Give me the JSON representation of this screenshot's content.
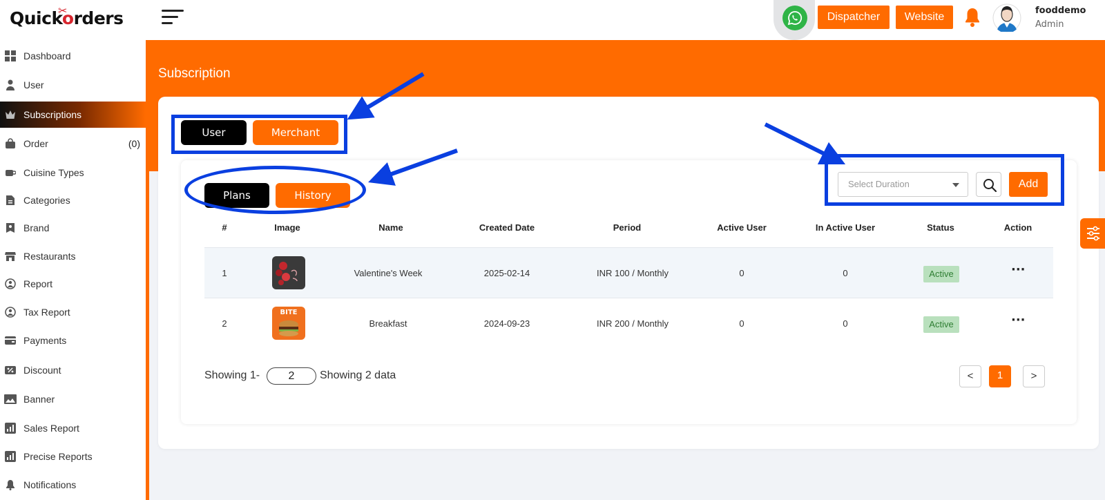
{
  "header": {
    "logo_pre": "Quick",
    "logo_post": "rders",
    "logo_o": "o",
    "dispatcher_label": "Dispatcher",
    "website_label": "Website",
    "user_name": "fooddemo",
    "user_role": "Admin"
  },
  "sidebar": {
    "items": [
      {
        "label": "Dashboard",
        "icon": "dashboard-icon"
      },
      {
        "label": "User",
        "icon": "user-icon"
      },
      {
        "label": "Subscriptions",
        "icon": "crown-icon"
      },
      {
        "label": "Order",
        "icon": "bag-icon",
        "count": "(0)"
      },
      {
        "label": "Cuisine Types",
        "icon": "cup-icon"
      },
      {
        "label": "Categories",
        "icon": "categories-icon"
      },
      {
        "label": "Brand",
        "icon": "brand-icon"
      },
      {
        "label": "Restaurants",
        "icon": "store-icon"
      },
      {
        "label": "Report",
        "icon": "report-icon"
      },
      {
        "label": "Tax Report",
        "icon": "tax-report-icon"
      },
      {
        "label": "Payments",
        "icon": "payments-icon"
      },
      {
        "label": "Discount",
        "icon": "discount-icon"
      },
      {
        "label": "Banner",
        "icon": "image-icon"
      },
      {
        "label": "Sales Report",
        "icon": "chart-icon"
      },
      {
        "label": "Precise Reports",
        "icon": "chart-icon"
      },
      {
        "label": "Notifications",
        "icon": "bell-icon"
      }
    ]
  },
  "page": {
    "title": "Subscription",
    "tabs": {
      "user": "User",
      "merchant": "Merchant"
    },
    "subtabs": {
      "plans": "Plans",
      "history": "History"
    },
    "duration_placeholder": "Select Duration",
    "add_label": "Add"
  },
  "table": {
    "headers": [
      "#",
      "Image",
      "Name",
      "Created Date",
      "Period",
      "Active User",
      "In Active User",
      "Status",
      "Action"
    ],
    "rows": [
      {
        "num": "1",
        "name": "Valentine's Week",
        "created": "2025-02-14",
        "period": "INR 100 / Monthly",
        "active": "0",
        "inactive": "0",
        "status": "Active",
        "image_text": "",
        "action": "···"
      },
      {
        "num": "2",
        "name": "Breakfast",
        "created": "2024-09-23",
        "period": "INR 200 / Monthly",
        "active": "0",
        "inactive": "0",
        "status": "Active",
        "image_text": "BITE",
        "action": "···"
      }
    ]
  },
  "footer": {
    "showing_prefix": "Showing 1-",
    "per_page": "2",
    "showing_suffix": "Showing 2 data",
    "prev": "<",
    "current_page": "1",
    "next": ">"
  },
  "colors": {
    "accent": "#ff6b00",
    "annotation": "#0a3fe0",
    "active_badge": "#b9e0bd"
  }
}
